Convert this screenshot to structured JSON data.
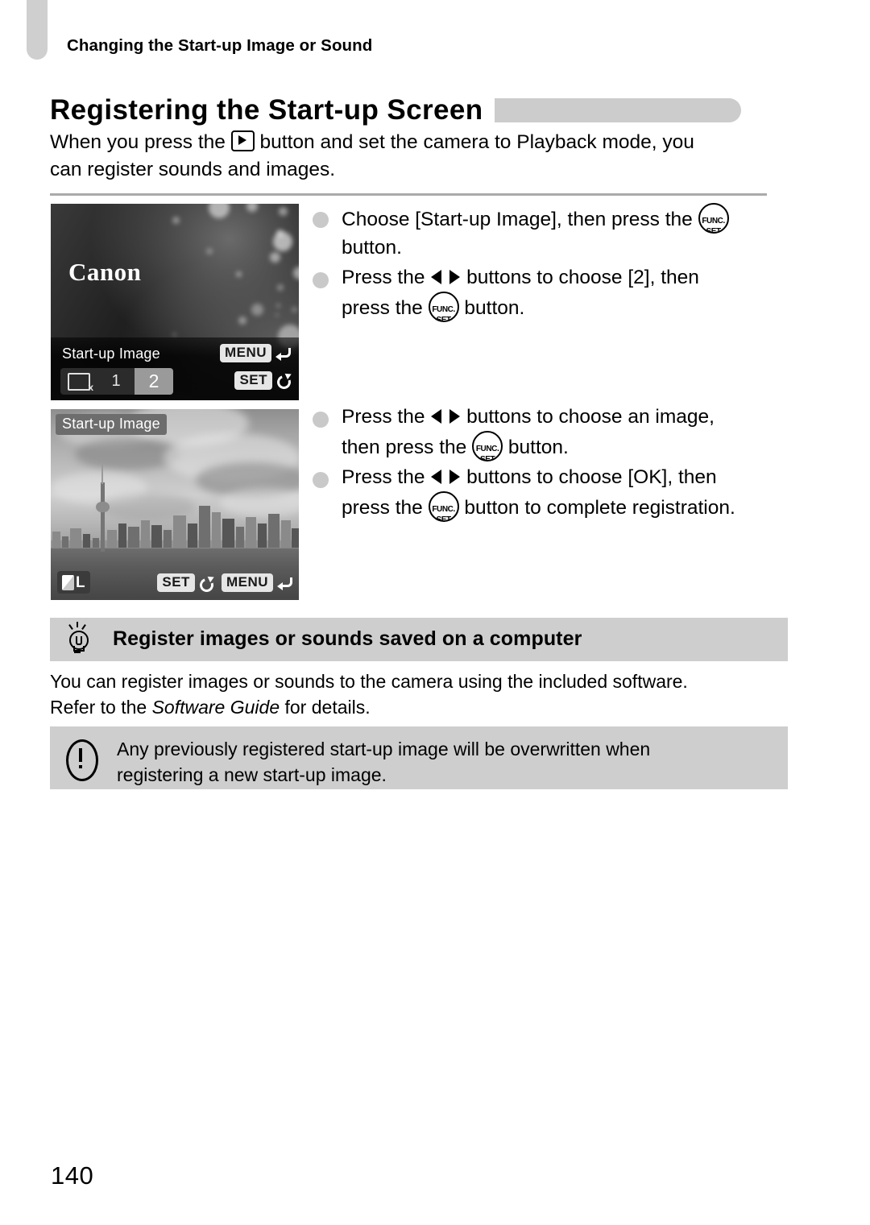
{
  "running_header": "Changing the Start-up Image or Sound",
  "title": "Registering the Start-up Screen",
  "intro": {
    "line1_before": "When you press the",
    "line1_after": "button and set the camera to Playback mode, you",
    "line2": "can register sounds and images."
  },
  "steps_group_1": [
    {
      "line1_before": "Choose [Start-up Image], then press the",
      "line1_after": "",
      "line2": "button."
    },
    {
      "line1_before": "Press the",
      "line1_after": "buttons to choose [2], then",
      "line2_before": "press the",
      "line2_after": "button."
    }
  ],
  "steps_group_2": [
    {
      "line1_before": "Press the",
      "line1_after": "buttons to choose an image,",
      "line2_before": "then press the",
      "line2_after": "button."
    },
    {
      "line1_before": "Press the",
      "line1_after": "buttons to choose [OK], then",
      "line2_before": "press the",
      "line2_after": "button to complete registration."
    }
  ],
  "screen_a": {
    "logo": "Canon",
    "label": "Start-up Image",
    "options": [
      "no-image",
      "1",
      "2"
    ],
    "selected_option": "2",
    "hint_menu_tag": "MENU",
    "hint_set_tag": "SET"
  },
  "screen_b": {
    "label": "Start-up Image",
    "quality_label": "L",
    "hint_set_tag": "SET",
    "hint_menu_tag": "MENU"
  },
  "tip": {
    "title": "Register images or sounds saved on a computer",
    "line1": "You can register images or sounds to the camera using the included software.",
    "line2_before": "Refer to the",
    "line2_italic": "Software Guide",
    "line2_after": "for details."
  },
  "caution": {
    "line1": "Any previously registered start-up image will be overwritten when",
    "line2": "registering a new start-up image."
  },
  "func_icon": {
    "top": "FUNC.",
    "bottom": "SET"
  },
  "page_number": "140",
  "colors": {
    "tab_grey": "#cfcfcf",
    "title_bar_grey": "#cccccc",
    "box_grey": "#cecece",
    "bullet_grey": "#c9c9c9",
    "rule_grey": "#aaaaaa"
  }
}
